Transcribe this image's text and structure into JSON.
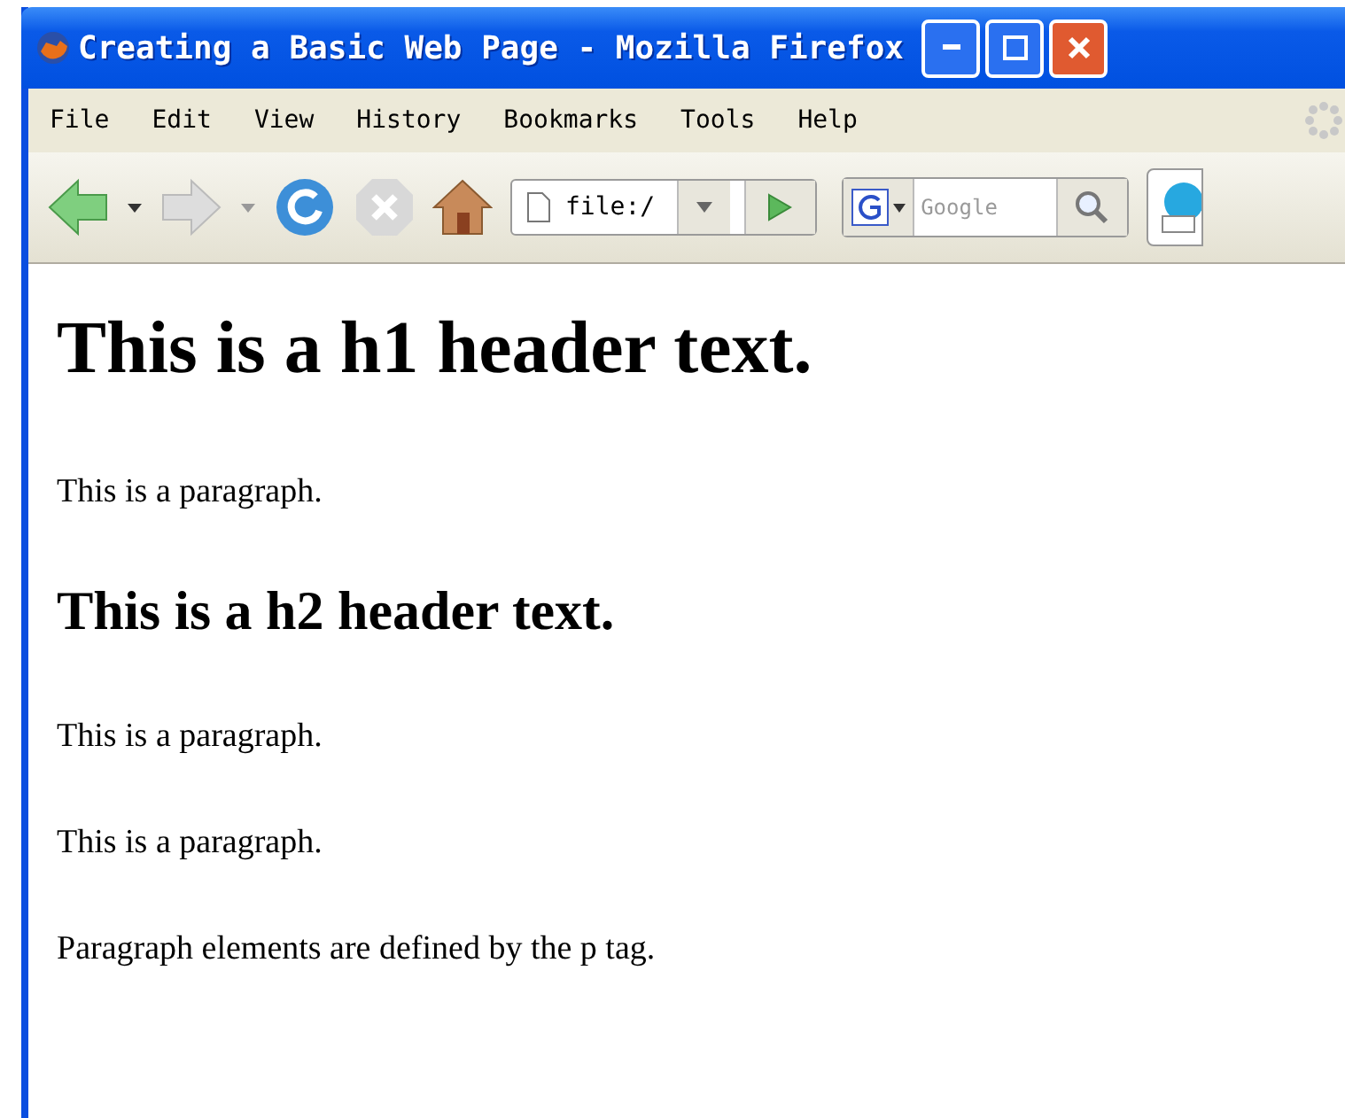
{
  "window": {
    "title": "Creating a Basic Web Page - Mozilla Firefox"
  },
  "menu": [
    "File",
    "Edit",
    "View",
    "History",
    "Bookmarks",
    "Tools",
    "Help"
  ],
  "toolbar": {
    "address": "file:/",
    "search_placeholder": "Google"
  },
  "content": [
    {
      "kind": "h1",
      "text": "This is a h1 header text."
    },
    {
      "kind": "p",
      "text": "This is a paragraph."
    },
    {
      "kind": "h2",
      "text": "This is a h2 header text."
    },
    {
      "kind": "p",
      "text": "This is a paragraph."
    },
    {
      "kind": "p",
      "text": "This is a paragraph."
    },
    {
      "kind": "p",
      "text": "Paragraph elements are defined by the p tag."
    }
  ]
}
